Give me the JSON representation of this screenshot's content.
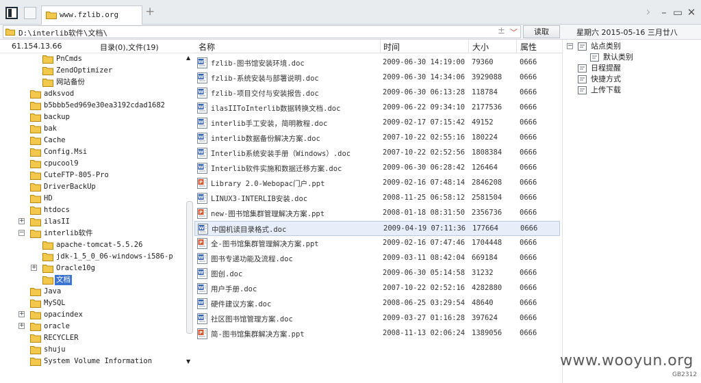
{
  "tab": {
    "title": "www.fzlib.org"
  },
  "address": {
    "path": "D:\\interlib软件\\文档\\",
    "go_label": "读取"
  },
  "date": "星期六 2015-05-16 三月廿八",
  "left": {
    "ip": "61.154.13.66",
    "counts": "目录(0),文件(19)"
  },
  "tree": [
    {
      "label": "PnCmds",
      "level": 2,
      "expander": ""
    },
    {
      "label": "ZendOptimizer",
      "level": 2,
      "expander": ""
    },
    {
      "label": "网站备份",
      "level": 2,
      "expander": ""
    },
    {
      "label": "adksvod",
      "level": 1,
      "expander": ""
    },
    {
      "label": "b5bbb5ed969e30ea3192cdad1682",
      "level": 1,
      "expander": ""
    },
    {
      "label": "backup",
      "level": 1,
      "expander": ""
    },
    {
      "label": "bak",
      "level": 1,
      "expander": ""
    },
    {
      "label": "Cache",
      "level": 1,
      "expander": ""
    },
    {
      "label": "Config.Msi",
      "level": 1,
      "expander": ""
    },
    {
      "label": "cpucool9",
      "level": 1,
      "expander": ""
    },
    {
      "label": "CuteFTP-805-Pro",
      "level": 1,
      "expander": ""
    },
    {
      "label": "DriverBackUp",
      "level": 1,
      "expander": ""
    },
    {
      "label": "HD",
      "level": 1,
      "expander": ""
    },
    {
      "label": "htdocs",
      "level": 1,
      "expander": ""
    },
    {
      "label": "ilasII",
      "level": 1,
      "expander": "+"
    },
    {
      "label": "interlib软件",
      "level": 1,
      "expander": "-"
    },
    {
      "label": "apache-tomcat-5.5.26",
      "level": 2,
      "expander": ""
    },
    {
      "label": "jdk-1_5_0_06-windows-i586-p",
      "level": 2,
      "expander": ""
    },
    {
      "label": "Oracle10g",
      "level": 2,
      "expander": "+"
    },
    {
      "label": "文档",
      "level": 2,
      "expander": "",
      "selected": true
    },
    {
      "label": "Java",
      "level": 1,
      "expander": ""
    },
    {
      "label": "MySQL",
      "level": 1,
      "expander": ""
    },
    {
      "label": "opacindex",
      "level": 1,
      "expander": "+"
    },
    {
      "label": "oracle",
      "level": 1,
      "expander": "+"
    },
    {
      "label": "RECYCLER",
      "level": 1,
      "expander": ""
    },
    {
      "label": "shuju",
      "level": 1,
      "expander": ""
    },
    {
      "label": "System Volume Information",
      "level": 1,
      "expander": ""
    }
  ],
  "columns": {
    "name": "名称",
    "time": "时间",
    "size": "大小",
    "attr": "属性"
  },
  "files": [
    {
      "name": "fzlib-图书馆安装环境.doc",
      "time": "2009-06-30 14:19:00",
      "size": "79360",
      "attr": "0666",
      "type": "doc"
    },
    {
      "name": "fzlib-系统安装与部署说明.doc",
      "time": "2009-06-30 14:34:06",
      "size": "3929088",
      "attr": "0666",
      "type": "doc"
    },
    {
      "name": "fzlib-项目交付与安装报告.doc",
      "time": "2009-06-30 06:13:28",
      "size": "118784",
      "attr": "0666",
      "type": "doc"
    },
    {
      "name": "ilasIIToInterlib数据转换文档.doc",
      "time": "2009-06-22 09:34:10",
      "size": "2177536",
      "attr": "0666",
      "type": "doc"
    },
    {
      "name": "interlib手工安装，简明教程.doc",
      "time": "2009-02-17 07:15:42",
      "size": "49152",
      "attr": "0666",
      "type": "doc"
    },
    {
      "name": "interlib数据备份解决方案.doc",
      "time": "2007-10-22 02:55:16",
      "size": "180224",
      "attr": "0666",
      "type": "doc"
    },
    {
      "name": "Interlib系统安装手册（Windows）.doc",
      "time": "2007-10-22 02:52:56",
      "size": "1808384",
      "attr": "0666",
      "type": "doc"
    },
    {
      "name": "Interlib软件实施和数据迁移方案.doc",
      "time": "2009-06-30 06:28:42",
      "size": "126464",
      "attr": "0666",
      "type": "doc"
    },
    {
      "name": "Library 2.0-Webopac门户.ppt",
      "time": "2009-02-16 07:48:14",
      "size": "2846208",
      "attr": "0666",
      "type": "ppt"
    },
    {
      "name": "LINUX3-INTERLIB安装.doc",
      "time": "2008-11-25 06:58:12",
      "size": "2581504",
      "attr": "0666",
      "type": "doc"
    },
    {
      "name": "new-图书馆集群管理解决方案.ppt",
      "time": "2008-01-18 08:31:50",
      "size": "2356736",
      "attr": "0666",
      "type": "ppt"
    },
    {
      "name": "中国机读目录格式.doc",
      "time": "2009-04-19 07:11:36",
      "size": "177664",
      "attr": "0666",
      "type": "doc",
      "selected": true
    },
    {
      "name": "全-图书馆集群管理解决方案.ppt",
      "time": "2009-02-16 07:47:46",
      "size": "1704448",
      "attr": "0666",
      "type": "ppt"
    },
    {
      "name": "图书专递功能及流程.doc",
      "time": "2009-03-11 08:42:04",
      "size": "669184",
      "attr": "0666",
      "type": "doc"
    },
    {
      "name": "图创.doc",
      "time": "2009-06-30 05:14:58",
      "size": "31232",
      "attr": "0666",
      "type": "doc"
    },
    {
      "name": "用户手册.doc",
      "time": "2007-10-22 02:52:16",
      "size": "4282880",
      "attr": "0666",
      "type": "doc"
    },
    {
      "name": "硬件建议方案.doc",
      "time": "2008-06-25 03:29:54",
      "size": "48640",
      "attr": "0666",
      "type": "doc"
    },
    {
      "name": "社区图书馆管理方案.doc",
      "time": "2009-03-27 01:16:28",
      "size": "397624",
      "attr": "0666",
      "type": "doc"
    },
    {
      "name": "简-图书馆集群解决方案.ppt",
      "time": "2008-11-13 02:06:24",
      "size": "1389056",
      "attr": "0666",
      "type": "ppt"
    }
  ],
  "right_panel": [
    {
      "label": "站点类别",
      "icon": "category-icon",
      "expander": "-"
    },
    {
      "label": "默认类别",
      "icon": "subcategory-icon",
      "expander": ""
    },
    {
      "label": "日程提醒",
      "icon": "schedule-icon",
      "expander": ""
    },
    {
      "label": "快捷方式",
      "icon": "shortcut-icon",
      "expander": ""
    },
    {
      "label": "上传下载",
      "icon": "transfer-icon",
      "expander": ""
    }
  ],
  "watermark": "www.wooyun.org",
  "corner_code": "GB2312",
  "colors": {
    "selection": "#3b74d1",
    "row_highlight": "#e8eef9",
    "folder": "#f2c94c",
    "doc_icon": "#2f5fb3",
    "ppt_icon": "#d9542b"
  }
}
